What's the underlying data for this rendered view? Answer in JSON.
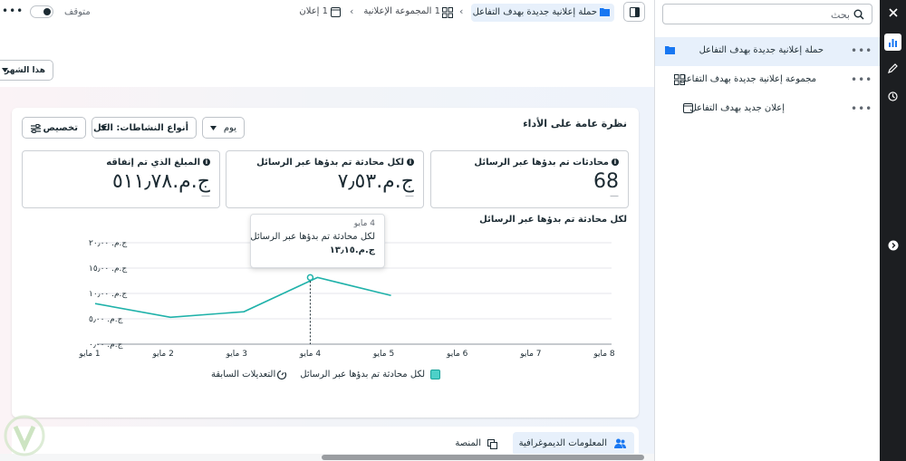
{
  "header": {
    "toggle_label": "متوقف",
    "crumb_campaign": "حملة إعلانية جديدة بهدف التفاعل",
    "crumb_adset": "1 المجموعة الإعلانية",
    "crumb_ad": "1 إعلان",
    "more": "•••"
  },
  "date_filter": "هذا الشهر",
  "overview": {
    "title": "نظرة عامة على الأداء",
    "customize": "تخصيص",
    "activity_types": "أنواع النشاطات: الكل",
    "granularity": "يوم"
  },
  "metrics": [
    {
      "title": "محادثات تم بدؤها عبر الرسائل",
      "value": "68",
      "delta": "—"
    },
    {
      "title": "لكل محادثة تم بدؤها عبر الرسائل",
      "value": "ج.م.‏٧٫٥٣",
      "delta": "—"
    },
    {
      "title": "المبلغ الذي تم إنفاقه",
      "value": "ج.م.‏٥١١٫٧٨",
      "delta": "—"
    }
  ],
  "chart_title": "لكل محادثة تم بدؤها عبر الرسائل",
  "chart_data": {
    "type": "line",
    "title": "لكل محادثة تم بدؤها عبر الرسائل",
    "x": [
      "1 مايو",
      "2 مايو",
      "3 مايو",
      "4 مايو",
      "5 مايو",
      "6 مايو",
      "7 مايو",
      "8 مايو"
    ],
    "y_ticks": [
      "ج.م. ٢٠٫٠٠",
      "ج.م. ١٥٫٠٠",
      "ج.م. ١٠٫٠٠",
      "ج.م. ٥٫٠٠",
      "ج.م. ٠٫٠٠"
    ],
    "y_tick_values": [
      20,
      15,
      10,
      5,
      0
    ],
    "ylim": [
      0,
      20
    ],
    "series": [
      {
        "name": "لكل محادثة تم بدؤها عبر الرسائل",
        "color": "#20b2aa",
        "values": [
          8,
          5.3,
          6.4,
          13.15,
          9.6,
          null,
          null,
          null
        ]
      }
    ],
    "highlight_index": 3,
    "legend": [
      "لكل محادثة تم بدؤها عبر الرسائل",
      "التعديلات السابقة"
    ],
    "legend_position": "bottom"
  },
  "tooltip": {
    "date": "4 مايو",
    "label": "لكل محادثة تم بدؤها عبر الرسائل",
    "value": "ج.م.‏١٣٫١٥"
  },
  "tabs": {
    "demographics": "المعلومات الديموغرافية",
    "platform": "المنصة"
  },
  "tree": {
    "search_placeholder": "بحث",
    "campaign": "حملة إعلانية جديدة بهدف التفاعل",
    "adset": "مجموعة إعلانية جديدة بهدف التفاعل",
    "ad": "إعلان جديد بهدف التفاعل",
    "more": "•••"
  },
  "colors": {
    "accent": "#1877f2",
    "series": "#20b2aa",
    "rail": "#1c1e21",
    "selected_row": "#e7f0fb"
  }
}
